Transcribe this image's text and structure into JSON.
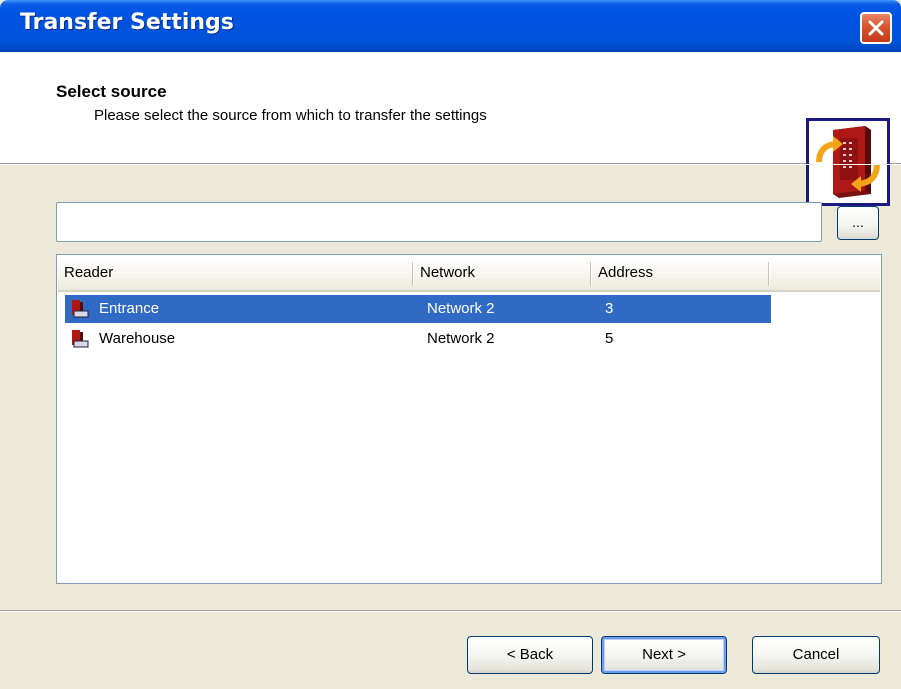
{
  "window": {
    "title": "Transfer Settings",
    "close_icon": "close-icon"
  },
  "header": {
    "title": "Select source",
    "subtitle": "Please select the source from which to transfer the settings",
    "icon": "reader-transfer-icon"
  },
  "source_path": {
    "value": "",
    "placeholder": ""
  },
  "browse_button": {
    "label": "..."
  },
  "list": {
    "columns": [
      "Reader",
      "Network",
      "Address"
    ],
    "rows": [
      {
        "reader": "Entrance",
        "network": "Network 2",
        "address": "3",
        "selected": true,
        "icon": "reader-icon"
      },
      {
        "reader": "Warehouse",
        "network": "Network 2",
        "address": "5",
        "selected": false,
        "icon": "reader-icon"
      }
    ]
  },
  "buttons": {
    "back": "< Back",
    "next": "Next >",
    "cancel": "Cancel"
  },
  "colors": {
    "titlebar": "#0055e5",
    "selection": "#316ac5",
    "dialog_bg": "#ece9d8",
    "close_button": "#d9532f"
  }
}
